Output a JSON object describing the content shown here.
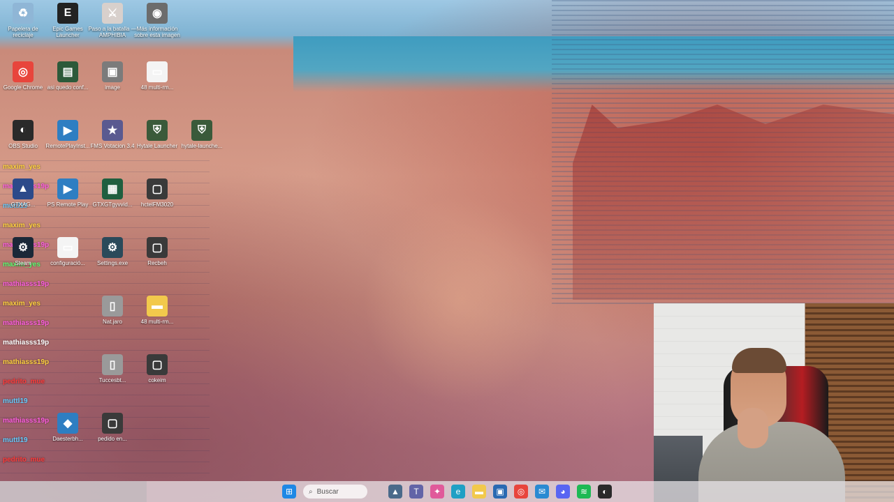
{
  "desktop_icons": [
    {
      "label": "Papelera de reciclaje",
      "icon": "recycle-bin-icon",
      "color": "#8fb6d6"
    },
    {
      "label": "Epic Games Launcher",
      "icon": "epic-games-icon",
      "color": "#222222"
    },
    {
      "label": "Paso a la batalla — AMPHIBIA",
      "icon": "game-shortcut-icon",
      "color": "#d8d0cc"
    },
    {
      "label": "Más información sobre esta imagen",
      "icon": "info-camera-icon",
      "color": "#6c6c6c"
    },
    {
      "label": "Google Chrome",
      "icon": "chrome-icon",
      "color": "#e8453c"
    },
    {
      "label": "asi quedo conf...",
      "icon": "document-icon",
      "color": "#2d5a3a"
    },
    {
      "label": "image",
      "icon": "image-file-icon",
      "color": "#7b7b7b"
    },
    {
      "label": "48 multi-rm...",
      "icon": "text-file-icon",
      "color": "#f4f4f4"
    },
    {
      "label": "OBS Studio",
      "icon": "obs-icon",
      "color": "#2a2a2a"
    },
    {
      "label": "RemotePlayInst...",
      "icon": "remote-play-icon",
      "color": "#2e7ec2"
    },
    {
      "label": "FMS Votacion 3.4",
      "icon": "fms-icon",
      "color": "#5a5a90"
    },
    {
      "label": "Hytale Launcher",
      "icon": "hytale-icon",
      "color": "#3a5a3a"
    },
    {
      "label": "hytale-launche...",
      "icon": "hytale-installer-icon",
      "color": "#3a5a3a"
    },
    {
      "label": "GTXAG...",
      "icon": "game-icon",
      "color": "#2c4a8a"
    },
    {
      "label": "PS Remote Play",
      "icon": "ps-remote-play-icon",
      "color": "#2e7ec2"
    },
    {
      "label": "GTXGTgyvvid...",
      "icon": "program-icon",
      "color": "#1f5f3f"
    },
    {
      "label": "hctelFM3020",
      "icon": "window-icon",
      "color": "#3a3a3a"
    },
    {
      "label": "Steam",
      "icon": "steam-icon",
      "color": "#1b2838"
    },
    {
      "label": "configuració...",
      "icon": "text-file-icon",
      "color": "#f4f4f4"
    },
    {
      "label": "Settings.exe",
      "icon": "settings-icon",
      "color": "#2a4a5a"
    },
    {
      "label": "Recbeh",
      "icon": "window-icon",
      "color": "#3a3a3a"
    },
    {
      "label": "Nat.jaro",
      "icon": "file-icon",
      "color": "#9a9a9a"
    },
    {
      "label": "48 multi-rm...",
      "icon": "folder-icon",
      "color": "#f2c94c"
    },
    {
      "label": "Tuccesbt...",
      "icon": "file-icon",
      "color": "#9a9a9a"
    },
    {
      "label": "cokeim",
      "icon": "window-icon",
      "color": "#3a3a3a"
    },
    {
      "label": "Daesterbh...",
      "icon": "ps-icon",
      "color": "#2e7ec2"
    },
    {
      "label": "pedido en...",
      "icon": "window-icon",
      "color": "#3a3a3a"
    }
  ],
  "chat_lines": [
    {
      "user": "maxim_yes",
      "color": "#ffd23f"
    },
    {
      "user": "mathiasss19p",
      "color": "#ff5ee0"
    },
    {
      "user": "muttl19",
      "color": "#66ccff"
    },
    {
      "user": "maxim_yes",
      "color": "#ffd23f"
    },
    {
      "user": "mathiasss19p",
      "color": "#ff5ee0"
    },
    {
      "user": "maxim_yes",
      "color": "#5cff72"
    },
    {
      "user": "mathiasss19p",
      "color": "#ff5ee0"
    },
    {
      "user": "maxim_yes",
      "color": "#ffd23f"
    },
    {
      "user": "mathiasss19p",
      "color": "#ff5ee0"
    },
    {
      "user": "mathiasss19p",
      "color": "#ffffff"
    },
    {
      "user": "mathiasss19p",
      "color": "#ffd23f"
    },
    {
      "user": "pedrito_mue",
      "color": "#ff3b3b"
    },
    {
      "user": "muttl19",
      "color": "#66ccff"
    },
    {
      "user": "mathiasss19p",
      "color": "#ff5ee0"
    },
    {
      "user": "muttl19",
      "color": "#66ccff"
    },
    {
      "user": "pedrito_mue",
      "color": "#ff3b3b"
    }
  ],
  "taskbar": {
    "search_placeholder": "Buscar",
    "apps": [
      {
        "name": "start-button",
        "icon": "windows-icon",
        "color": "#1e88e5"
      },
      {
        "name": "widgets-button",
        "icon": "landscape-icon",
        "color": "#4a6a8a"
      },
      {
        "name": "teams-button",
        "icon": "teams-icon",
        "color": "#6264a7"
      },
      {
        "name": "copilot-button",
        "icon": "copilot-icon",
        "color": "#e05a9a"
      },
      {
        "name": "edge-button",
        "icon": "edge-icon",
        "color": "#1fa0c4"
      },
      {
        "name": "explorer-button",
        "icon": "folder-icon",
        "color": "#f2c94c"
      },
      {
        "name": "store-button",
        "icon": "store-icon",
        "color": "#2a6ab2"
      },
      {
        "name": "chrome-button",
        "icon": "chrome-icon",
        "color": "#e8453c"
      },
      {
        "name": "mail-button",
        "icon": "mail-icon",
        "color": "#2a8ad2"
      },
      {
        "name": "discord-button",
        "icon": "discord-icon",
        "color": "#5865f2"
      },
      {
        "name": "spotify-button",
        "icon": "spotify-icon",
        "color": "#1db954"
      },
      {
        "name": "obs-button",
        "icon": "obs-icon",
        "color": "#2a2a2a"
      }
    ]
  }
}
